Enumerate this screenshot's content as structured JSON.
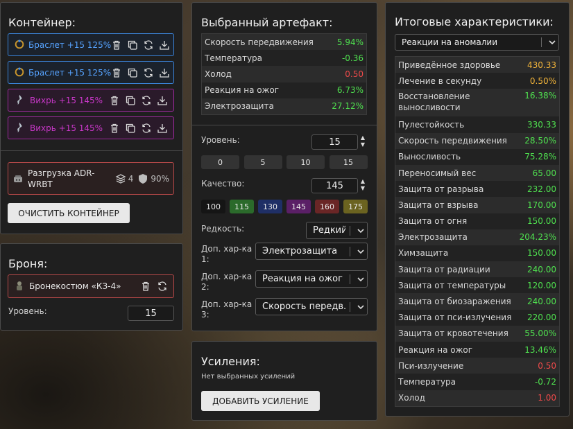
{
  "container": {
    "title": "Контейнер:",
    "artifacts": [
      {
        "name": "Браслет +15 125%",
        "color": "blue"
      },
      {
        "name": "Браслет +15 125%",
        "color": "blue"
      },
      {
        "name": "Вихрь +15 145%",
        "color": "purple"
      },
      {
        "name": "Вихрь +15 145%",
        "color": "purple"
      }
    ],
    "gear": {
      "name_line1": "Разгрузка ADR-",
      "name_line2": "WRBT",
      "slots": "4",
      "durability": "90%"
    },
    "clear_label": "ОЧИСТИТЬ КОНТЕЙНЕР"
  },
  "armor": {
    "title": "Броня:",
    "name": "Бронекостюм «КЗ-4»",
    "level_label": "Уровень:",
    "level_value": "15"
  },
  "artifact": {
    "title": "Выбранный артефакт:",
    "stats": [
      {
        "name": "Скорость передвижения",
        "value": "5.94%",
        "tone": "green"
      },
      {
        "name": "Температура",
        "value": "-0.36",
        "tone": "green"
      },
      {
        "name": "Холод",
        "value": "0.50",
        "tone": "red"
      },
      {
        "name": "Реакция на ожог",
        "value": "6.73%",
        "tone": "green"
      },
      {
        "name": "Электрозащита",
        "value": "27.12%",
        "tone": "green"
      }
    ],
    "level_label": "Уровень:",
    "level_value": "15",
    "level_presets": [
      "0",
      "5",
      "10",
      "15"
    ],
    "quality_label": "Качество:",
    "quality_value": "145",
    "quality_presets": [
      {
        "label": "100",
        "color": "#151515"
      },
      {
        "label": "115",
        "color": "#2b6a2b"
      },
      {
        "label": "130",
        "color": "#1f2f66"
      },
      {
        "label": "145",
        "color": "#5a1f66"
      },
      {
        "label": "160",
        "color": "#6a2626"
      },
      {
        "label": "175",
        "color": "#6b6320"
      }
    ],
    "rarity_label": "Редкость:",
    "rarity_value": "Редкий",
    "extras": [
      {
        "label_line1": "Доп. хар-ка",
        "label_line2": "1:",
        "value": "Электрозащита"
      },
      {
        "label_line1": "Доп. хар-ка",
        "label_line2": "2:",
        "value": "Реакция на ожог"
      },
      {
        "label_line1": "Доп. хар-ка",
        "label_line2": "3:",
        "value": "Скорость передв..."
      }
    ]
  },
  "boosts": {
    "title": "Усиления:",
    "empty_text": "Нет выбранных усилений",
    "add_label": "ДОБАВИТЬ УСИЛЕНИЕ"
  },
  "totals": {
    "title": "Итоговые характеристики:",
    "filter_value": "Реакции на аномалии",
    "stats": [
      {
        "name": "Приведённое здоровье",
        "value": "430.33",
        "tone": "yellow"
      },
      {
        "name": "Лечение в секунду",
        "value": "0.50%",
        "tone": "yellow"
      },
      {
        "name": "Восстановление выносливости",
        "value": "16.38%",
        "tone": "green",
        "double": true
      },
      {
        "name": "Пулестойкость",
        "value": "330.33",
        "tone": "green"
      },
      {
        "name": "Скорость передвижения",
        "value": "28.50%",
        "tone": "green"
      },
      {
        "name": "Выносливость",
        "value": "75.28%",
        "tone": "green"
      },
      {
        "name": "Переносимый вес",
        "value": "65.00",
        "tone": "green"
      },
      {
        "name": "Защита от разрыва",
        "value": "232.00",
        "tone": "green"
      },
      {
        "name": "Защита от взрыва",
        "value": "170.00",
        "tone": "green"
      },
      {
        "name": "Защита от огня",
        "value": "150.00",
        "tone": "green"
      },
      {
        "name": "Электрозащита",
        "value": "204.23%",
        "tone": "green"
      },
      {
        "name": "Химзащита",
        "value": "150.00",
        "tone": "green"
      },
      {
        "name": "Защита от радиации",
        "value": "240.00",
        "tone": "green"
      },
      {
        "name": "Защита от температуры",
        "value": "120.00",
        "tone": "green"
      },
      {
        "name": "Защита от биозаражения",
        "value": "240.00",
        "tone": "green"
      },
      {
        "name": "Защита от пси-излучения",
        "value": "220.00",
        "tone": "green"
      },
      {
        "name": "Защита от кровотечения",
        "value": "55.00%",
        "tone": "green"
      },
      {
        "name": "Реакция на ожог",
        "value": "13.46%",
        "tone": "green"
      },
      {
        "name": "Пси-излучение",
        "value": "0.50",
        "tone": "red"
      },
      {
        "name": "Температура",
        "value": "-0.72",
        "tone": "green"
      },
      {
        "name": "Холод",
        "value": "1.00",
        "tone": "red"
      }
    ]
  }
}
